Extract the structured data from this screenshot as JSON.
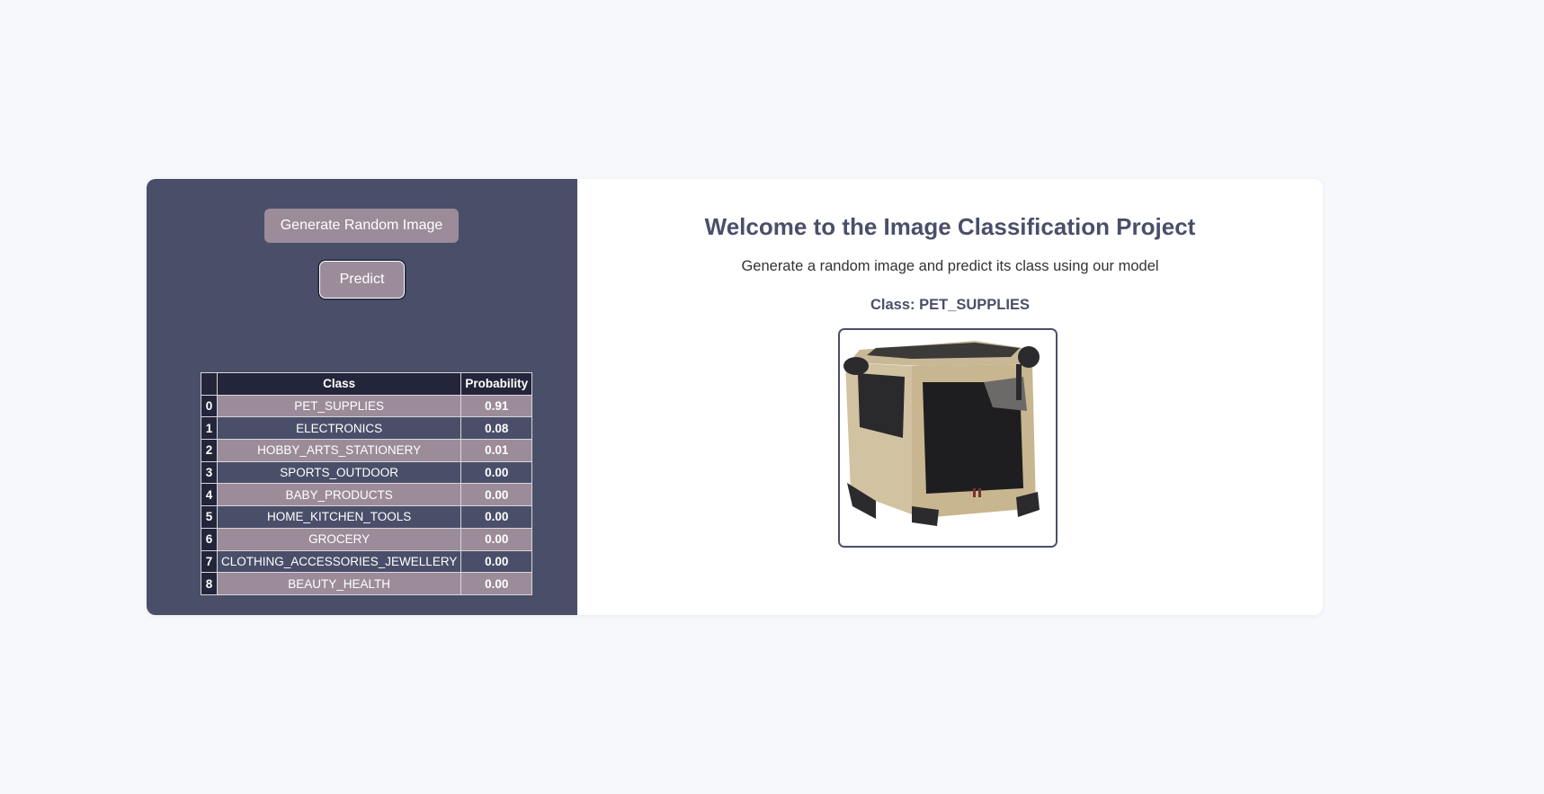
{
  "sidebar": {
    "generate_button": "Generate Random Image",
    "predict_button": "Predict"
  },
  "table": {
    "headers": {
      "index": "",
      "class": "Class",
      "probability": "Probability"
    },
    "rows": [
      {
        "index": "0",
        "class": "PET_SUPPLIES",
        "probability": "0.91"
      },
      {
        "index": "1",
        "class": "ELECTRONICS",
        "probability": "0.08"
      },
      {
        "index": "2",
        "class": "HOBBY_ARTS_STATIONERY",
        "probability": "0.01"
      },
      {
        "index": "3",
        "class": "SPORTS_OUTDOOR",
        "probability": "0.00"
      },
      {
        "index": "4",
        "class": "BABY_PRODUCTS",
        "probability": "0.00"
      },
      {
        "index": "5",
        "class": "HOME_KITCHEN_TOOLS",
        "probability": "0.00"
      },
      {
        "index": "6",
        "class": "GROCERY",
        "probability": "0.00"
      },
      {
        "index": "7",
        "class": "CLOTHING_ACCESSORIES_JEWELLERY",
        "probability": "0.00"
      },
      {
        "index": "8",
        "class": "BEAUTY_HEALTH",
        "probability": "0.00"
      }
    ]
  },
  "main": {
    "title": "Welcome to the Image Classification Project",
    "subtitle": "Generate a random image and predict its class using our model",
    "class_label": "Class: PET_SUPPLIES"
  },
  "colors": {
    "sidebar_bg": "#4a4f69",
    "accent": "#9c8c9a",
    "header_dark": "#23253a",
    "page_bg": "#f7f8fb"
  },
  "icons": {
    "product_image": "pet-crate-photo"
  }
}
